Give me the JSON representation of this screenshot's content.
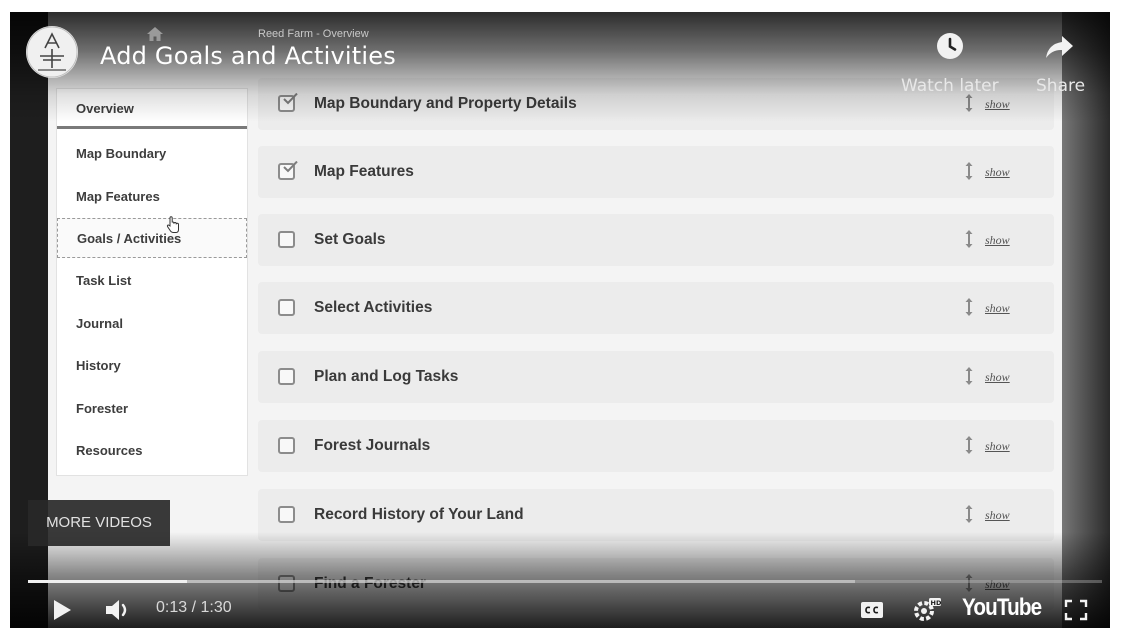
{
  "video": {
    "title": "Add Goals and Activities",
    "watch_later_label": "Watch later",
    "share_label": "Share",
    "more_videos_label": "MORE VIDEOS",
    "time": "0:13 / 1:30",
    "progress_played_fraction": 0.148,
    "progress_loaded_fraction": 0.77,
    "youtube_label": "YouTube",
    "icons": [
      "play-icon",
      "volume-icon",
      "captions-icon",
      "settings-hd-icon",
      "fullscreen-icon",
      "clock-icon",
      "share-icon"
    ]
  },
  "app": {
    "breadcrumb": "Reed Farm - Overview",
    "sidebar": {
      "items": [
        {
          "label": "Overview",
          "state": "active"
        },
        {
          "label": "Map Boundary",
          "state": ""
        },
        {
          "label": "Map Features",
          "state": ""
        },
        {
          "label": "Goals / Activities",
          "state": "selected"
        },
        {
          "label": "Task List",
          "state": ""
        },
        {
          "label": "Journal",
          "state": ""
        },
        {
          "label": "History",
          "state": ""
        },
        {
          "label": "Forester",
          "state": ""
        },
        {
          "label": "Resources",
          "state": ""
        }
      ]
    },
    "rows": [
      {
        "title": "Map Boundary and Property Details",
        "checked": true,
        "show": "show"
      },
      {
        "title": "Map Features",
        "checked": true,
        "show": "show"
      },
      {
        "title": "Set Goals",
        "checked": false,
        "show": "show"
      },
      {
        "title": "Select Activities",
        "checked": false,
        "show": "show"
      },
      {
        "title": "Plan and Log Tasks",
        "checked": false,
        "show": "show"
      },
      {
        "title": "Forest Journals",
        "checked": false,
        "show": "show"
      },
      {
        "title": "Record History of Your Land",
        "checked": false,
        "show": "show"
      },
      {
        "title": "Find a Forester",
        "checked": false,
        "show": "show"
      }
    ]
  }
}
